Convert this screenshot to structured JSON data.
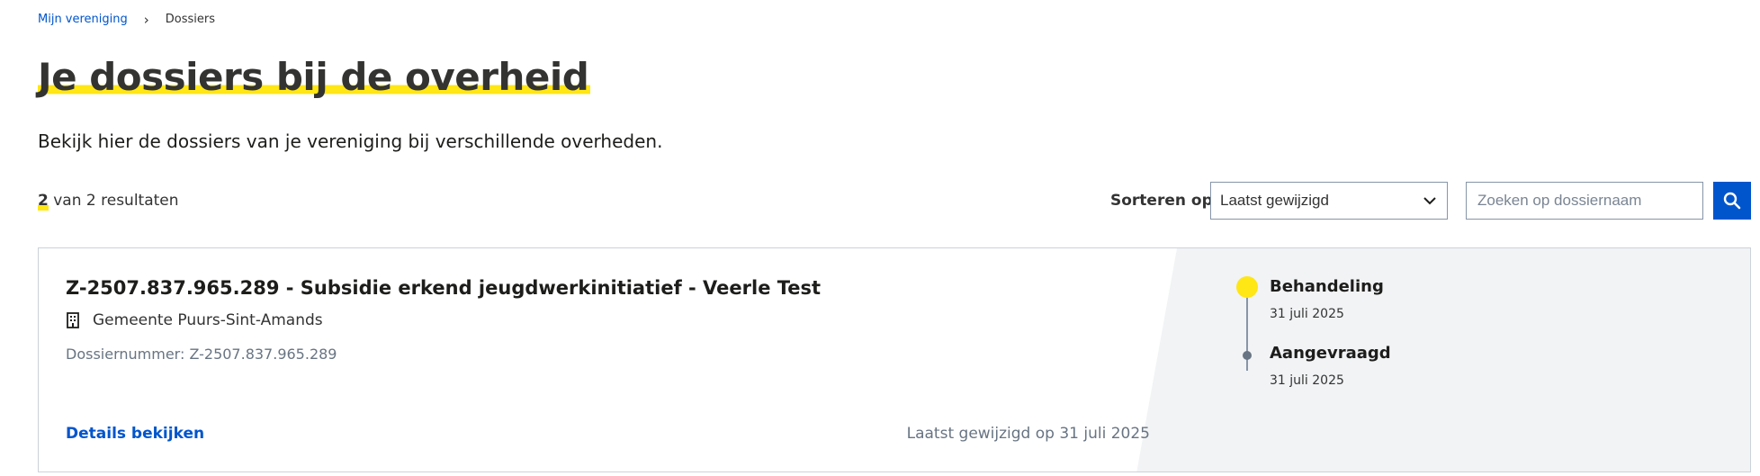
{
  "breadcrumb": {
    "home": "Mijn vereniging",
    "current": "Dossiers"
  },
  "page": {
    "title": "Je dossiers bij de overheid",
    "intro": "Bekijk hier de dossiers van je vereniging bij verschillende overheden."
  },
  "results": {
    "count": "2",
    "suffix": " van 2 resultaten"
  },
  "sort": {
    "label": "Sorteren op",
    "selected": "Laatst gewijzigd"
  },
  "search": {
    "placeholder": "Zoeken op dossiernaam",
    "value": "",
    "button_icon": "search-icon"
  },
  "dossiers": [
    {
      "title": "Z-2507.837.965.289 - Subsidie erkend jeugdwerkinitiatief - Veerle Test",
      "organization_icon": "building-icon",
      "organization": "Gemeente Puurs-Sint-Amands",
      "number": "Dossiernummer: Z-2507.837.965.289",
      "details_link": "Details bekijken",
      "last_modified": "Laatst gewijzigd op 31 juli 2025",
      "timeline": [
        {
          "label": "Behandeling",
          "date": "31 juli 2025",
          "active": true
        },
        {
          "label": "Aangevraagd",
          "date": "31 juli 2025",
          "active": false
        }
      ]
    }
  ],
  "colors": {
    "link": "#0055cc",
    "highlight": "#ffe615",
    "panel": "#f1f3f5",
    "border": "#cbd2da",
    "muted": "#687483"
  }
}
